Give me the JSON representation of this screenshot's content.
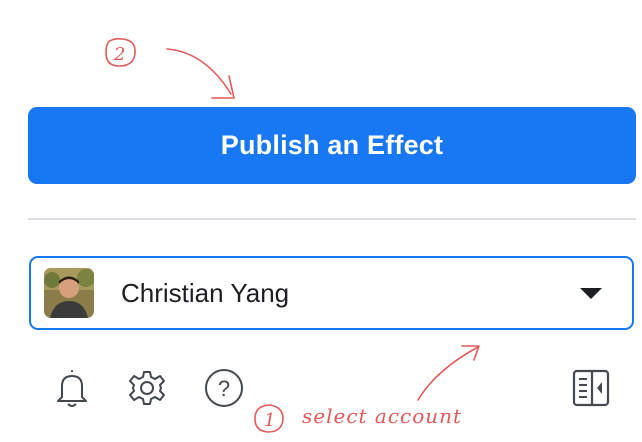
{
  "publish": {
    "label": "Publish an Effect"
  },
  "account": {
    "name": "Christian Yang"
  },
  "annotations": {
    "step_two": "2",
    "step_one": "1",
    "note": "select account"
  },
  "colors": {
    "accent": "#1877f2",
    "annotation": "#e25a5a"
  },
  "icons": {
    "bell": "bell-icon",
    "gear": "gear-icon",
    "help": "help-icon",
    "panel": "panel-toggle-icon"
  }
}
